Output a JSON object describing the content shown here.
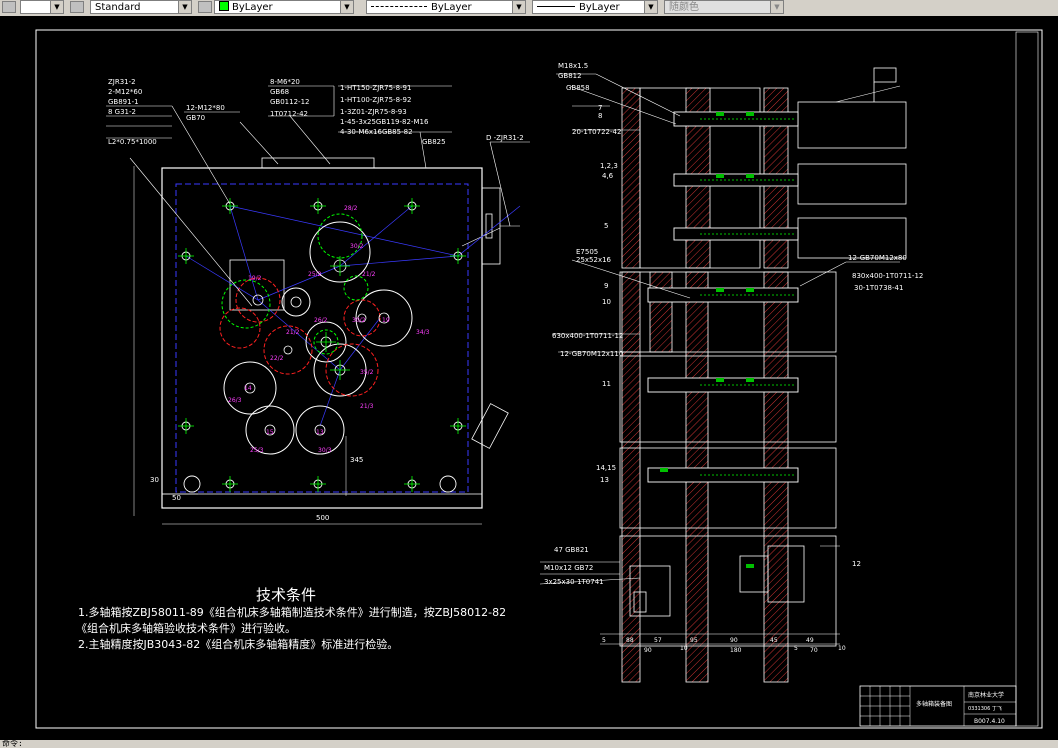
{
  "toolbar": {
    "text_style": "Standard",
    "layer_color": "ByLayer",
    "linetype": "ByLayer",
    "lineweight": "ByLayer",
    "plot_style": "随颜色"
  },
  "drawing": {
    "tech_title": "技术条件",
    "tech_line1": "1.多轴箱按ZBJ58011-89《组合机床多轴箱制造技术条件》进行制造，按ZBJ58012-82",
    "tech_line2": "《组合机床多轴箱验收技术条件》进行验收。",
    "tech_line3": "2.主轴精度按JB3043-82《组合机床多轴箱精度》标准进行检验。",
    "left_labels": {
      "zjr": "ZJR31-2",
      "m12x60": "2-M12*60",
      "gb891": "GB891-1",
      "g31": "8 G31-2",
      "s1000": "L2*0.75*1000",
      "m12x80": "12-M12*80",
      "gb70": "GB70",
      "m6x20": "8-M6*20",
      "gb68": "GB68",
      "m12x12": "GB0112-12",
      "t0712": "1T0712-42",
      "ht150": "1-HT150-ZJR75-8-91",
      "ht100": "1-HT100-ZJR75-8-92",
      "z301": "1-3Z01-ZJR75-8-93",
      "m45": "1-45-3x25GB119-82-M16",
      "m30": "4-30-M6x16GB85-82",
      "gb825": "GB825",
      "dzjr": "D -ZJR31-2",
      "dim500": "500",
      "dim50": "50",
      "dim345": "345",
      "dim30": "30"
    },
    "gear_labels": {
      "g1": "19/2",
      "g2": "28/2",
      "g3": "25/2",
      "g4": "30/2",
      "g5": "21/2",
      "g6": "19",
      "g7": "30/2",
      "g8": "34/3",
      "g9": "26/2",
      "g10": "21/2",
      "g11": "14",
      "g12": "26/3",
      "g13": "15",
      "g14": "25/3",
      "g15": "30/3",
      "g16": "13",
      "g17": "21/3",
      "g18": "22/2",
      "g19": "35/2"
    },
    "right_labels": {
      "m18": "M18x1.5",
      "gb812": "GB812",
      "gb858": "GB858",
      "n7": "7",
      "n8": "8",
      "t0722": "20-1T0722-42",
      "n12": "1,2,3",
      "n46": "4,6",
      "n5": "5",
      "e7505": "E7505",
      "s25": "25x52x16",
      "n9": "9",
      "n10": "10",
      "gb70m12": "12-GB70M12x80",
      "t0711": "830x400-1T0711-12",
      "t0738": "30-1T0738-41",
      "s630": "630x400-1T0711-12",
      "gb70b": "12-GB70M12x110",
      "n11": "11",
      "n1415": "14,15",
      "n13": "13",
      "gb821": "47  GB821",
      "m10": "M10x12  GB72",
      "t0741": "3x25x30-1T0741",
      "n12b": "12",
      "d5": "5",
      "d88": "88",
      "d57": "57",
      "d95": "95",
      "d90": "90",
      "d45": "45",
      "d49": "49",
      "d90b": "90",
      "d10": "10",
      "d180": "180",
      "d5b": "5",
      "d70": "70",
      "d10b": "10"
    },
    "title_block": {
      "name": "多轴箱装备图",
      "school": "南京林业大学",
      "code": "0331306 丁飞",
      "drawing_no": "B007.4.10"
    }
  },
  "status": {
    "command": "命令:"
  }
}
